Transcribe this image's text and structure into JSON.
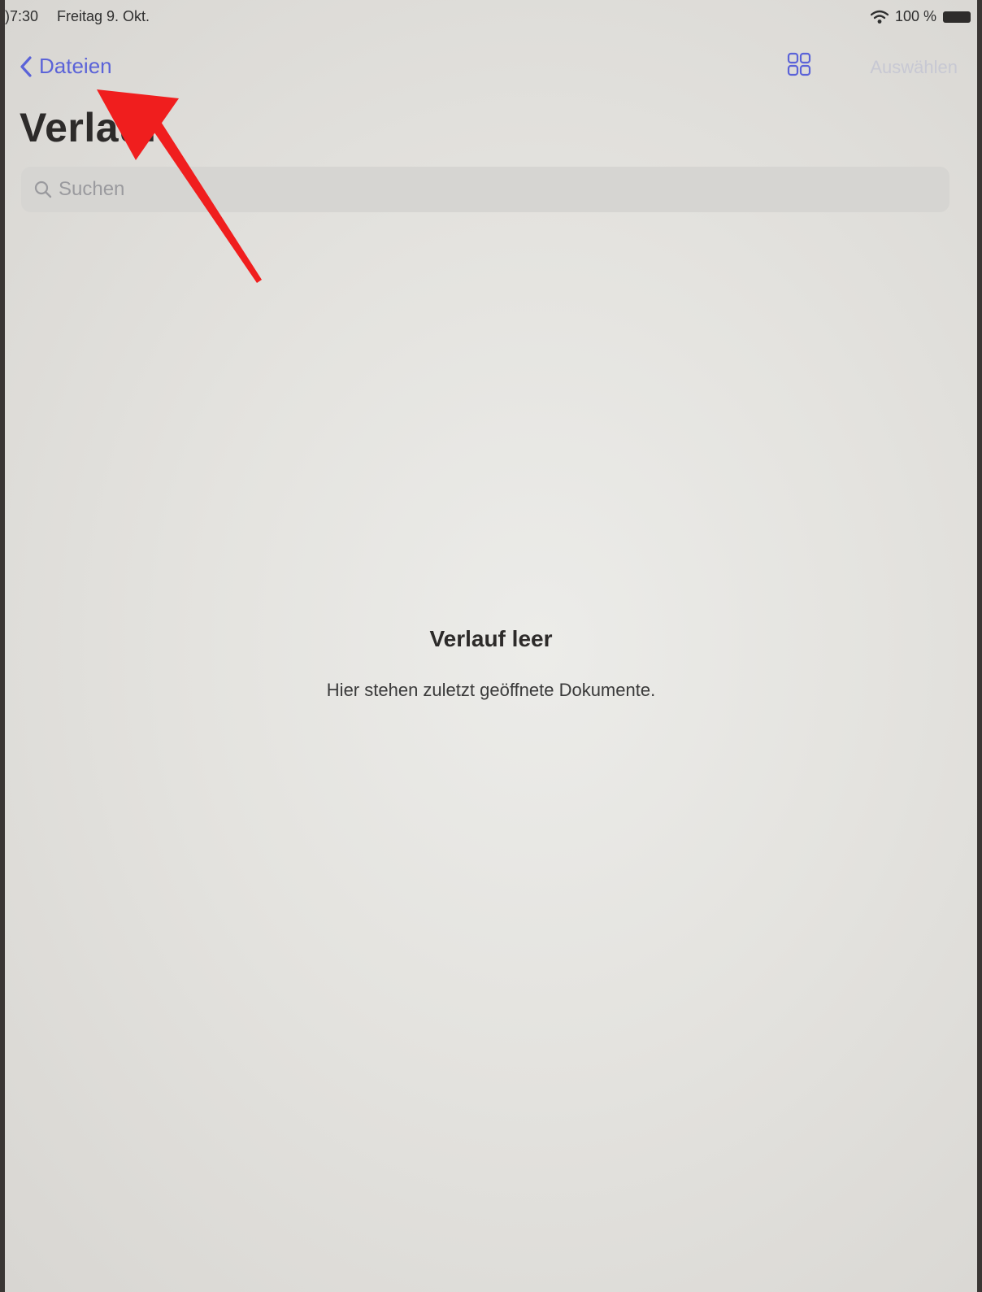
{
  "status_bar": {
    "time": ")7:30",
    "date": "Freitag 9. Okt.",
    "battery": "100 %",
    "icons": [
      "wifi-icon",
      "battery-icon"
    ]
  },
  "nav": {
    "back_label": "Dateien",
    "back_icon": "chevron-left-icon",
    "view_icon": "grid-view-icon",
    "select_label": "Auswählen",
    "accent_color": "#5b63d8"
  },
  "page": {
    "title": "Verlauf"
  },
  "search": {
    "placeholder": "Suchen",
    "icon": "search-icon"
  },
  "empty_state": {
    "title": "Verlauf leer",
    "subtitle": "Hier stehen zuletzt geöffnete Dokumente."
  },
  "annotation": {
    "type": "arrow",
    "color": "#f01e1e",
    "target": "back-button"
  }
}
